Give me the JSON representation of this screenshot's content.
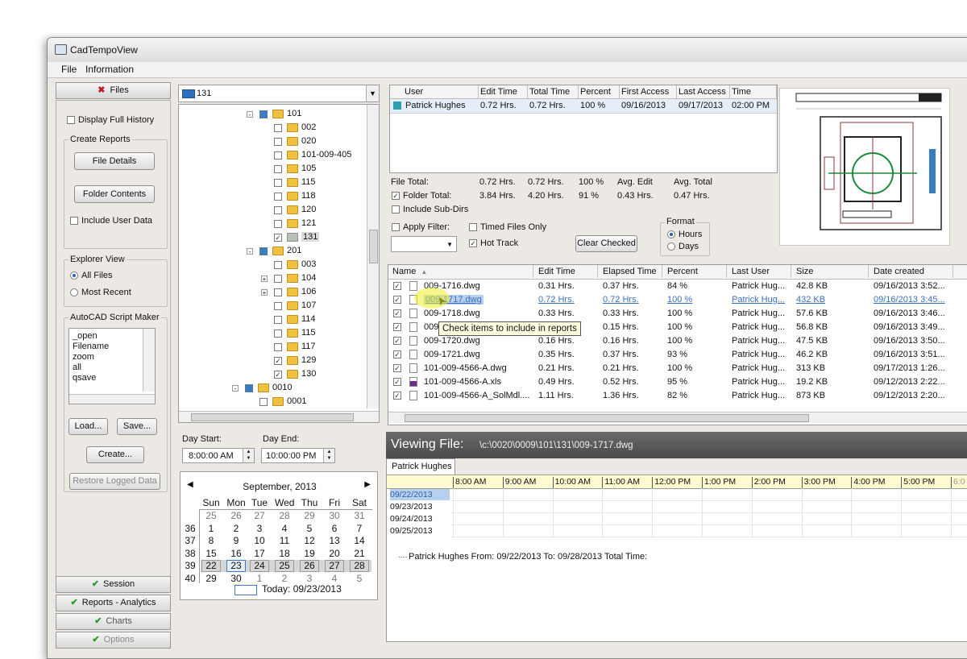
{
  "window": {
    "title": "CadTempoView"
  },
  "menu": [
    "File",
    "Information"
  ],
  "sidebar": {
    "files_tab": "Files",
    "display_full_history": "Display Full History",
    "create_reports": "Create Reports",
    "file_details": "File Details",
    "folder_contents": "Folder Contents",
    "include_user_data": "Include User Data",
    "explorer_view": "Explorer View",
    "all_files": "All Files",
    "most_recent": "Most Recent",
    "script_maker": "AutoCAD Script Maker",
    "script_lines": [
      "_open",
      "Filename",
      "zoom",
      "all",
      "qsave"
    ],
    "load": "Load...",
    "save": "Save...",
    "create": "Create...",
    "restore": "Restore Logged Data",
    "bottom_tabs": [
      "Session",
      "Reports - Analytics",
      "Charts",
      "Options"
    ]
  },
  "tree": {
    "root_label": "131",
    "nodes": [
      {
        "label": "101",
        "type": "blue",
        "expander": "-"
      },
      {
        "label": "002"
      },
      {
        "label": "020"
      },
      {
        "label": "101-009-405"
      },
      {
        "label": "105"
      },
      {
        "label": "115"
      },
      {
        "label": "118"
      },
      {
        "label": "120"
      },
      {
        "label": "121"
      },
      {
        "label": "131",
        "checked": true,
        "gray": true,
        "selected": true
      },
      {
        "label": "201",
        "type": "blue",
        "expander": "-"
      },
      {
        "label": "003"
      },
      {
        "label": "104",
        "expander": "+"
      },
      {
        "label": "106",
        "expander": "+"
      },
      {
        "label": "107"
      },
      {
        "label": "114"
      },
      {
        "label": "115"
      },
      {
        "label": "117"
      },
      {
        "label": "129",
        "checked": true
      },
      {
        "label": "130",
        "checked": true
      },
      {
        "label": "0010",
        "type": "blue",
        "expander": "-"
      },
      {
        "label": "0001"
      }
    ]
  },
  "day": {
    "start_label": "Day Start:",
    "end_label": "Day End:",
    "start_value": "8:00:00 AM",
    "end_value": "10:00:00 PM"
  },
  "calendar": {
    "month": "September, 2013",
    "days": [
      "Sun",
      "Mon",
      "Tue",
      "Wed",
      "Thu",
      "Fri",
      "Sat"
    ],
    "weeks": [
      {
        "wk": "",
        "d": [
          "25",
          "26",
          "27",
          "28",
          "29",
          "30",
          "31"
        ]
      },
      {
        "wk": "36",
        "d": [
          "1",
          "2",
          "3",
          "4",
          "5",
          "6",
          "7"
        ]
      },
      {
        "wk": "37",
        "d": [
          "8",
          "9",
          "10",
          "11",
          "12",
          "13",
          "14"
        ]
      },
      {
        "wk": "38",
        "d": [
          "15",
          "16",
          "17",
          "18",
          "19",
          "20",
          "21"
        ]
      },
      {
        "wk": "39",
        "d": [
          "22",
          "23",
          "24",
          "25",
          "26",
          "27",
          "28"
        ]
      },
      {
        "wk": "40",
        "d": [
          "29",
          "30",
          "1",
          "2",
          "3",
          "4",
          "5"
        ]
      }
    ],
    "today": "Today: 09/23/2013"
  },
  "user_table": {
    "headers": [
      "User",
      "Edit Time",
      "Total Time",
      "Percent",
      "First Access",
      "Last Access",
      "Time"
    ],
    "rows": [
      [
        "Patrick Hughes",
        "0.72 Hrs.",
        "0.72 Hrs.",
        "100 %",
        "09/16/2013",
        "09/17/2013",
        "02:00 PM"
      ]
    ],
    "swatch": "#2ca0b0"
  },
  "totals": {
    "file_total": "File Total:",
    "ft_edit": "0.72 Hrs.",
    "ft_total": "0.72 Hrs.",
    "ft_pct": "100 %",
    "avg_edit_label": "Avg. Edit",
    "avg_total_label": "Avg. Total",
    "folder_total": "Folder Total:",
    "fo_edit": "3.84 Hrs.",
    "fo_total": "4.20 Hrs.",
    "fo_pct": "91 %",
    "avg_edit": "0.43 Hrs.",
    "avg_total": "0.47 Hrs.",
    "include_subdirs": "Include Sub-Dirs"
  },
  "filters": {
    "apply_filter": "Apply Filter:",
    "timed_files_only": "Timed Files Only",
    "hot_track": "Hot Track",
    "clear_checked": "Clear Checked",
    "format": "Format",
    "hours": "Hours",
    "days": "Days"
  },
  "file_table": {
    "headers": [
      "Name",
      "Edit Time",
      "Elapsed Time",
      "Percent",
      "Last User",
      "Size",
      "Date created"
    ],
    "rows": [
      [
        "009-1716.dwg",
        "0.31 Hrs.",
        "0.37 Hrs.",
        "84 %",
        "Patrick Hug...",
        "42.8 KB",
        "09/16/2013 3:52..."
      ],
      [
        "009-1717.dwg",
        "0.72 Hrs.",
        "0.72 Hrs.",
        "100 %",
        "Patrick Hug...",
        "432 KB",
        "09/16/2013 3:45..."
      ],
      [
        "009-1718.dwg",
        "0.33 Hrs.",
        "0.33 Hrs.",
        "100 %",
        "Patrick Hug...",
        "57.6 KB",
        "09/16/2013 3:46..."
      ],
      [
        "009",
        "0.15 Hrs.",
        "0.15 Hrs.",
        "100 %",
        "Patrick Hug...",
        "56.8 KB",
        "09/16/2013 3:49..."
      ],
      [
        "009-1720.dwg",
        "0.16 Hrs.",
        "0.16 Hrs.",
        "100 %",
        "Patrick Hug...",
        "47.5 KB",
        "09/16/2013 3:50..."
      ],
      [
        "009-1721.dwg",
        "0.35 Hrs.",
        "0.37 Hrs.",
        "93 %",
        "Patrick Hug...",
        "46.2 KB",
        "09/16/2013 3:51..."
      ],
      [
        "101-009-4566-A.dwg",
        "0.21 Hrs.",
        "0.21 Hrs.",
        "100 %",
        "Patrick Hug...",
        "313 KB",
        "09/17/2013 1:26..."
      ],
      [
        "101-009-4566-A.xls",
        "0.49 Hrs.",
        "0.52 Hrs.",
        "95 %",
        "Patrick Hug...",
        "19.2 KB",
        "09/12/2013 2:22..."
      ],
      [
        "101-009-4566-A_SolMdl....",
        "1.11 Hrs.",
        "1.36 Hrs.",
        "82 %",
        "Patrick Hug...",
        "873 KB",
        "09/12/2013 2:20..."
      ]
    ],
    "tooltip": "Check items to include in reports"
  },
  "viewing": {
    "label": "Viewing File:",
    "path": "\\c:\\0020\\0009\\101\\131\\009-1717.dwg"
  },
  "timeline": {
    "tab": "Patrick Hughes",
    "hours": [
      "8:00 AM",
      "9:00 AM",
      "10:00 AM",
      "11:00 AM",
      "12:00 PM",
      "1:00 PM",
      "2:00 PM",
      "3:00 PM",
      "4:00 PM",
      "5:00 PM",
      "6:0"
    ],
    "dates": [
      "09/22/2013",
      "09/23/2013",
      "09/24/2013",
      "09/25/2013"
    ],
    "summary": "Patrick Hughes  From: 09/22/2013 To: 09/28/2013  Total Time:"
  }
}
